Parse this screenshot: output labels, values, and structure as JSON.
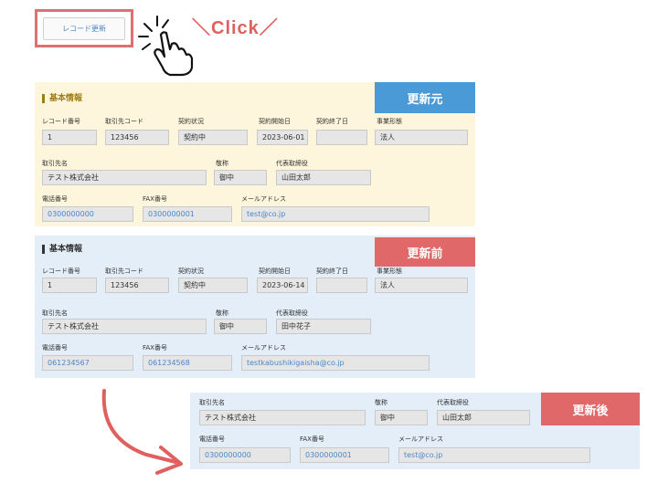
{
  "top": {
    "button_label": "レコード更新",
    "click_text": "＼Click／"
  },
  "badges": {
    "source": "更新元",
    "before": "更新前",
    "after": "更新後"
  },
  "labels": {
    "section": "基本情報",
    "record_no": "レコード番号",
    "client_code": "取引先コード",
    "contract_status": "契約状況",
    "contract_start": "契約開始日",
    "contract_end": "契約終了日",
    "business_type": "事業形態",
    "client_name": "取引先名",
    "honorific": "敬称",
    "representative": "代表取締役",
    "phone": "電話番号",
    "fax": "FAX番号",
    "email": "メールアドレス"
  },
  "source": {
    "record_no": "1",
    "client_code": "123456",
    "contract_status": "契約中",
    "contract_start": "2023-06-01",
    "contract_end": "",
    "business_type": "法人",
    "client_name": "テスト株式会社",
    "honorific": "御中",
    "representative": "山田太郎",
    "phone": "0300000000",
    "fax": "0300000001",
    "email": "test@co.jp"
  },
  "before": {
    "record_no": "1",
    "client_code": "123456",
    "contract_status": "契約中",
    "contract_start": "2023-06-14",
    "contract_end": "",
    "business_type": "法人",
    "client_name": "テスト株式会社",
    "honorific": "御中",
    "representative": "田中花子",
    "phone": "061234567",
    "fax": "061234568",
    "email": "testkabushikigaisha@co.jp"
  },
  "after": {
    "client_name": "テスト株式会社",
    "honorific": "御中",
    "representative": "山田太郎",
    "phone": "0300000000",
    "fax": "0300000001",
    "email": "test@co.jp"
  },
  "colors": {
    "accent_red": "#e16868",
    "accent_blue": "#4a9ad8",
    "link": "#4a86c8"
  },
  "icons": {
    "hand": "pointing-hand-icon",
    "arrow": "curved-arrow-icon"
  }
}
